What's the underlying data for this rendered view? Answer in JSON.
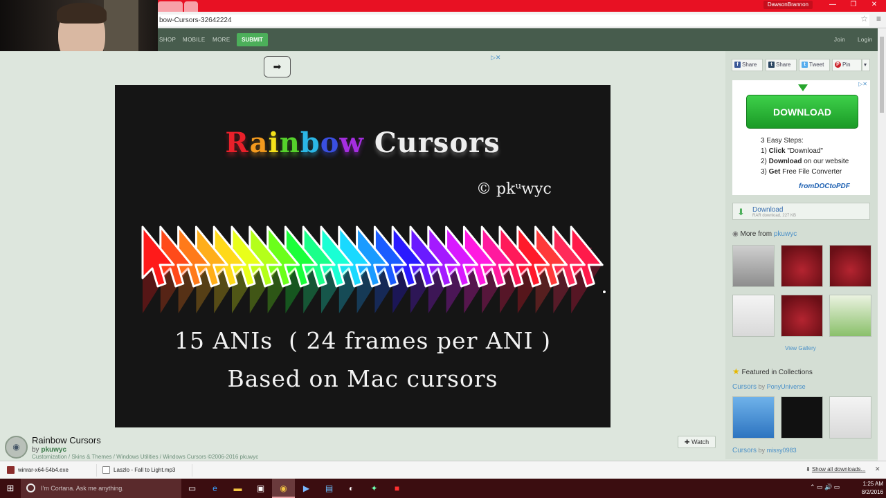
{
  "browser": {
    "user_name": "DawsonBrannon",
    "url": "bow-Cursors-32642224",
    "win_min": "—",
    "win_max": "❐",
    "win_close": "✕"
  },
  "nav": {
    "items": [
      "SHOP",
      "MOBILE",
      "MORE"
    ],
    "submit": "SUBMIT",
    "join": "Join",
    "login": "Login"
  },
  "preview": {
    "title_rainbow": [
      "R",
      "a",
      "i",
      "n",
      "b",
      "o",
      "w"
    ],
    "rainbow_colors": [
      "#e8202a",
      "#f39a1e",
      "#f4e11a",
      "#55d22b",
      "#2bb7e6",
      "#3a4fe0",
      "#a52ee0"
    ],
    "title_rest": "Cursors",
    "credit": "© pkᵘwyc",
    "line1": "15 ANIs  ( 24 frames per ANI )",
    "line2": "Based on Mac cursors",
    "arrow_colors": [
      "#ff1a1a",
      "#ff4a1a",
      "#ff7a1a",
      "#ffae1a",
      "#ffd91a",
      "#e9ff1a",
      "#b4ff1a",
      "#6bff1a",
      "#1aff3a",
      "#1aff8a",
      "#1affd4",
      "#1ad9ff",
      "#1a9bff",
      "#1a5cff",
      "#2a1aff",
      "#6a1aff",
      "#a41aff",
      "#d81aff",
      "#ff1ae0",
      "#ff1a9e",
      "#ff1a5a",
      "#ff1a2a",
      "#ff3a3a",
      "#ff2a5a",
      "#ff1a4a"
    ]
  },
  "page": {
    "arrow_btn": "➡",
    "title": "Rainbow Cursors",
    "by": "by",
    "author": "pkuwyc",
    "breadcrumbs": "Customization / Skins & Themes / Windows Utilities / Windows Cursors   ©2006-2016 pkuwyc",
    "watch": "Watch"
  },
  "sidebar": {
    "share": [
      {
        "label": "Share",
        "icon": "f",
        "color": "#3b5998"
      },
      {
        "label": "Share",
        "icon": "t",
        "color": "#2c4762"
      },
      {
        "label": "Tweet",
        "icon": "t",
        "color": "#55acee"
      },
      {
        "label": "Pin",
        "icon": "P",
        "color": "#cb2027"
      }
    ],
    "ad": {
      "button": "DOWNLOAD",
      "steps_title": "3 Easy Steps:",
      "step1_pre": "1) ",
      "step1_b": "Click",
      "step1_post": " \"Download\"",
      "step2_pre": "2) ",
      "step2_b": "Download",
      "step2_post": " on our website",
      "step3_pre": "3) ",
      "step3_b": "Get",
      "step3_post": " Free File Converter",
      "brand": "fromDOCtoPDF"
    },
    "download": {
      "label": "Download",
      "sub": "RAR download, 227 KB"
    },
    "more_from_pre": "More from ",
    "more_from_user": "pkuwyc",
    "view_gallery": "View Gallery",
    "featured": "Featured in Collections",
    "coll1": {
      "name": "Cursors",
      "by": "by",
      "user": "PonyUniverse"
    },
    "coll2": {
      "name": "Cursors",
      "by": "by",
      "user": "missy0983"
    }
  },
  "shelf": {
    "file1": "winrar-x64-54b4.exe",
    "file2": "Laszlo - Fall to Light.mp3",
    "show_all": "Show all downloads...",
    "close": "✕"
  },
  "taskbar": {
    "cortana": "I'm Cortana. Ask me anything.",
    "time": "1:25 AM",
    "date": "8/2/2016"
  }
}
